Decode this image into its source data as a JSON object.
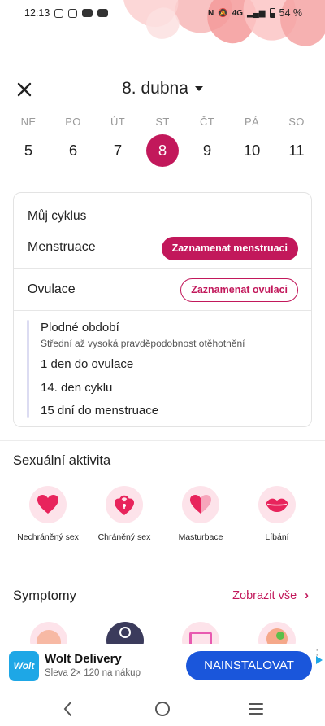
{
  "status_bar": {
    "time": "12:13",
    "network": "4G",
    "battery": "54 %"
  },
  "header": {
    "date_title": "8. dubna",
    "close_icon": "close-icon"
  },
  "week": {
    "days": [
      {
        "name": "NE",
        "num": "5"
      },
      {
        "name": "PO",
        "num": "6"
      },
      {
        "name": "ÚT",
        "num": "7"
      },
      {
        "name": "ST",
        "num": "8"
      },
      {
        "name": "ČT",
        "num": "9"
      },
      {
        "name": "PÁ",
        "num": "10"
      },
      {
        "name": "SO",
        "num": "11"
      }
    ],
    "selected_index": 3
  },
  "cycle": {
    "title": "Můj cyklus",
    "menstruation_label": "Menstruace",
    "menstruation_button": "Zaznamenat menstruaci",
    "ovulation_label": "Ovulace",
    "ovulation_button": "Zaznamenat ovulaci",
    "fertile_title": "Plodné období",
    "fertile_sub": "Střední až vysoká pravděpodobnost otěhotnění",
    "line1": "1 den do ovulace",
    "line2": "14. den cyklu",
    "line3": "15 dní do menstruace"
  },
  "sexual_activity": {
    "title": "Sexuální aktivita",
    "items": [
      {
        "label": "Nechráněný sex",
        "icon": "heart-icon"
      },
      {
        "label": "Chráněný sex",
        "icon": "heart-lock-icon"
      },
      {
        "label": "Masturbace",
        "icon": "half-heart-icon"
      },
      {
        "label": "Líbání",
        "icon": "lips-icon"
      }
    ]
  },
  "symptoms": {
    "title": "Symptomy",
    "see_all": "Zobrazit vše"
  },
  "ad": {
    "logo_text": "Wolt",
    "title": "Wolt Delivery",
    "subtitle": "Sleva 2× 120 na nákup",
    "button": "NAINSTALOVAT"
  },
  "colors": {
    "accent": "#c2185b",
    "pink_bg": "#fde3ea",
    "ad_button": "#1a56db"
  }
}
